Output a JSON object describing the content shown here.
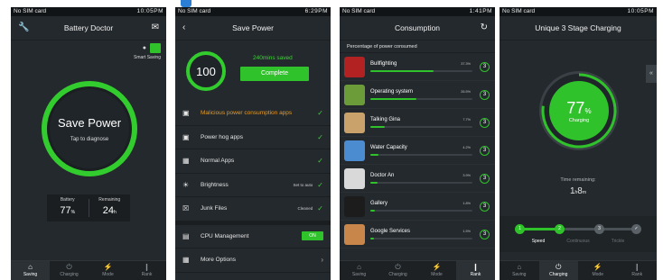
{
  "colors": {
    "accent": "#2fc22a",
    "warning": "#e79a20",
    "background": "#24292d"
  },
  "statusbar": {
    "p1": {
      "left": "No SIM card",
      "right": "10:05PM"
    },
    "p2": {
      "left": "No SIM card",
      "right": "6:29PM"
    },
    "p3": {
      "left": "No SIM card",
      "right": "1:41PM"
    },
    "p4": {
      "left": "No SIM card",
      "right": "10:05PM"
    }
  },
  "tabs": [
    "Saving",
    "Charging",
    "Mode",
    "Rank"
  ],
  "battery_doctor": {
    "title": "Battery Doctor",
    "smart_saving_label": "Smart Saving",
    "ring_title": "Save Power",
    "ring_sub": "Tap to diagnose",
    "battery_label": "Battery",
    "battery_value": "77",
    "battery_unit": "%",
    "remaining_label": "Remaining",
    "remaining_value": "24",
    "remaining_unit": "h"
  },
  "save_power": {
    "title": "Save Power",
    "score": "100",
    "saved_text": "240mins saved",
    "complete_label": "Complete",
    "items": [
      {
        "label": "Malicious power consumption apps",
        "status": "",
        "icon": "app-icon"
      },
      {
        "label": "Power hog apps",
        "status": "",
        "icon": "app-icon"
      },
      {
        "label": "Normal Apps",
        "status": "",
        "icon": "grid-icon"
      },
      {
        "label": "Brightness",
        "status": "Set to auto",
        "icon": "sun-icon"
      },
      {
        "label": "Junk Files",
        "status": "Cleaned",
        "icon": "trash-icon"
      },
      {
        "label": "CPU Management",
        "status": "ON",
        "icon": "lock-icon"
      },
      {
        "label": "More Options",
        "status": "",
        "icon": "grid-icon"
      }
    ]
  },
  "consumption": {
    "title": "Consumption",
    "subtitle": "Percentage of power consumed",
    "apps": [
      {
        "name": "Bullfighting",
        "pct": "37.3%",
        "fraction": 0.62,
        "rank": "3",
        "color": "#b22222"
      },
      {
        "name": "Operating system",
        "pct": "26.5%",
        "fraction": 0.45,
        "rank": "3",
        "color": "#6c9c3a"
      },
      {
        "name": "Talking Gina",
        "pct": "7.7%",
        "fraction": 0.14,
        "rank": "3",
        "color": "#c8a26a"
      },
      {
        "name": "Water Capacity",
        "pct": "4.2%",
        "fraction": 0.08,
        "rank": "3",
        "color": "#4a8ccf"
      },
      {
        "name": "Doctor An",
        "pct": "3.9%",
        "fraction": 0.07,
        "rank": "3",
        "color": "#d9d9d9"
      },
      {
        "name": "Gallery",
        "pct": "1.8%",
        "fraction": 0.04,
        "rank": "3",
        "color": "#1c1c1c"
      },
      {
        "name": "Google Services",
        "pct": "1.5%",
        "fraction": 0.035,
        "rank": "3",
        "color": "#c9864a"
      }
    ]
  },
  "charging": {
    "title": "Unique 3 Stage Charging",
    "percent": "77",
    "percent_unit": "%",
    "ring_fraction": 0.77,
    "ring_label": "Charging",
    "time_label": "Time remaining:",
    "time_hours": "1",
    "time_hours_unit": "h",
    "time_minutes": "8",
    "time_minutes_unit": "m",
    "stages": [
      "Speed",
      "Continuous",
      "Trickle"
    ],
    "stage_numbers": [
      "1",
      "2",
      "3"
    ],
    "active_stage": 1
  }
}
